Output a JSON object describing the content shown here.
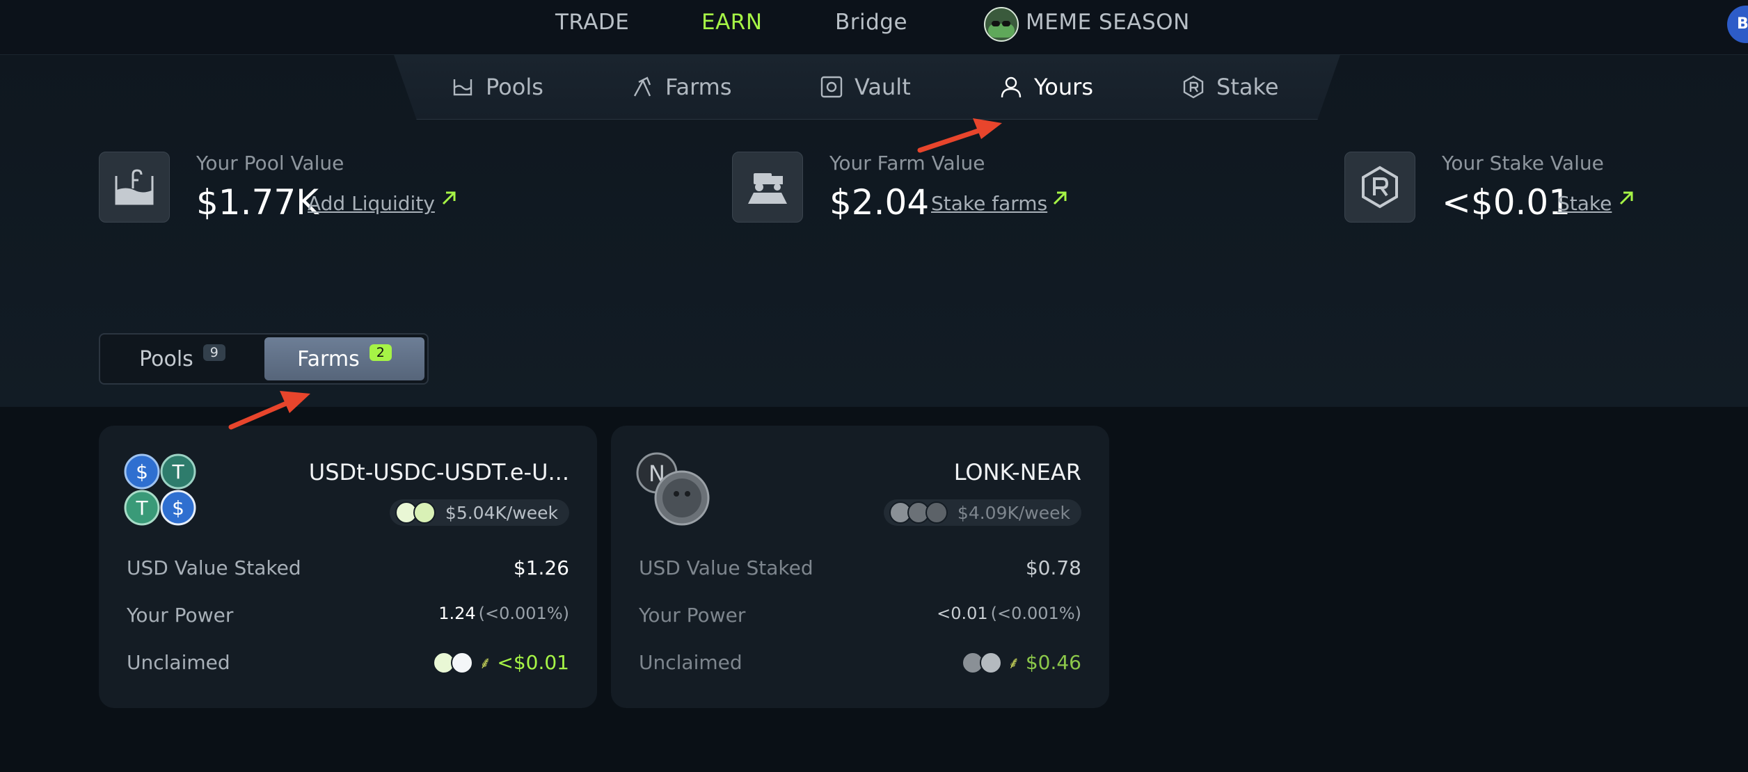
{
  "topnav": {
    "items": [
      "TRADE",
      "EARN",
      "Bridge",
      "MEME SEASON"
    ],
    "active": "EARN",
    "corner_avatar": "B"
  },
  "subtabs": {
    "items": [
      "Pools",
      "Farms",
      "Vault",
      "Yours",
      "Stake"
    ],
    "active": "Yours"
  },
  "stats": {
    "pool": {
      "label": "Your Pool Value",
      "value": "$1.77K",
      "link": "Add Liquidity"
    },
    "farm": {
      "label": "Your Farm Value",
      "value": "$2.04",
      "link": "Stake farms"
    },
    "stake": {
      "label": "Your Stake Value",
      "value": "<$0.01",
      "link": "Stake"
    }
  },
  "toggle": {
    "pools": {
      "label": "Pools",
      "count": "9"
    },
    "farms": {
      "label": "Farms",
      "count": "2"
    },
    "active": "Farms"
  },
  "cards": [
    {
      "name": "USDt-USDC-USDT.e-U...",
      "reward": "$5.04K/week",
      "rows": {
        "staked_label": "USD Value Staked",
        "staked_value": "$1.26",
        "power_label": "Your Power",
        "power_value": "1.24",
        "power_pct": "(<0.001%)",
        "unclaimed_label": "Unclaimed",
        "unclaimed_value": "<$0.01"
      }
    },
    {
      "name": "LONK-NEAR",
      "reward": "$4.09K/week",
      "rows": {
        "staked_label": "USD Value Staked",
        "staked_value": "$0.78",
        "power_label": "Your Power",
        "power_value": "<0.01",
        "power_pct": "(<0.001%)",
        "unclaimed_label": "Unclaimed",
        "unclaimed_value": "$0.46"
      }
    }
  ],
  "colors": {
    "accent": "#a6f446",
    "background": "#0b1118",
    "card": "#141c24",
    "annotation_arrow": "#e8452c"
  }
}
